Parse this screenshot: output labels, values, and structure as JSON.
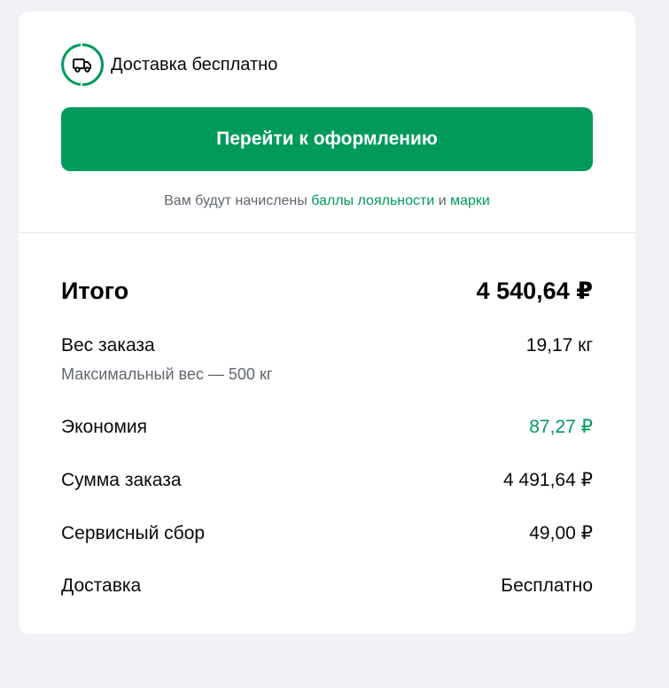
{
  "delivery": {
    "icon": "truck-icon",
    "label": "Доставка бесплатно",
    "accent_color": "#009a5b"
  },
  "checkout_button": {
    "label": "Перейти к оформлению",
    "color": "#009a5b"
  },
  "bonus_note": {
    "prefix": "Вам будут начислены",
    "points_link": "баллы лояльности",
    "conjunction": "и",
    "stamps_link": "марки"
  },
  "summary": {
    "total": {
      "label": "Итого",
      "value": "4 540,64 ₽"
    },
    "weight": {
      "label": "Вес заказа",
      "value": "19,17 кг",
      "hint": "Максимальный вес — 500 кг"
    },
    "saving": {
      "label": "Экономия",
      "value": "87,27 ₽",
      "color": "#009a5b"
    },
    "order_sum": {
      "label": "Сумма заказа",
      "value": "4 491,64 ₽"
    },
    "service_fee": {
      "label": "Сервисный сбор",
      "value": "49,00 ₽"
    },
    "shipping": {
      "label": "Доставка",
      "value": "Бесплатно"
    }
  }
}
